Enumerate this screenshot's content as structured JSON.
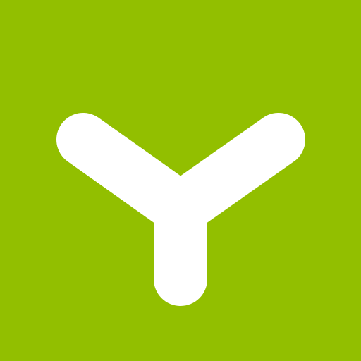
{
  "app_icon": {
    "icon_name": "y-fork-logo-icon",
    "background_color": "#92BF00",
    "glyph_color": "#FFFFFF"
  }
}
